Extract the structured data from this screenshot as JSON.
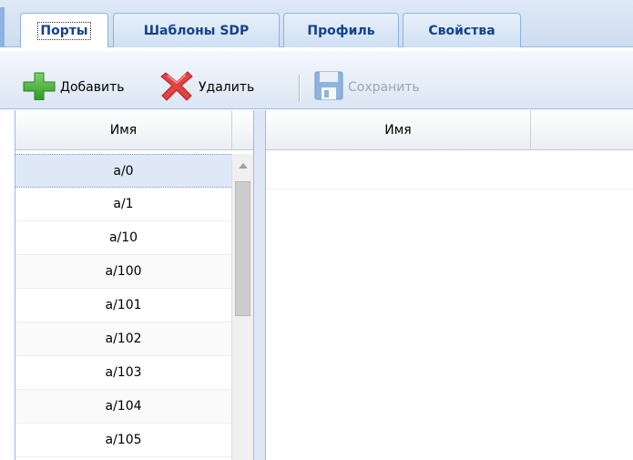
{
  "tabs": [
    {
      "label": "Порты",
      "active": true
    },
    {
      "label": "Шаблоны SDP",
      "active": false
    },
    {
      "label": "Профиль",
      "active": false
    },
    {
      "label": "Свойства",
      "active": false
    }
  ],
  "toolbar": {
    "add_label": "Добавить",
    "delete_label": "Удалить",
    "save_label": "Сохранить",
    "add_icon": "plus-icon",
    "delete_icon": "red-x-icon",
    "save_icon": "floppy-disk-icon"
  },
  "left_grid": {
    "column_header": "Имя",
    "rows": [
      "a/0",
      "a/1",
      "a/10",
      "a/100",
      "a/101",
      "a/102",
      "a/103",
      "a/104",
      "a/105"
    ],
    "selected_index": 0
  },
  "right_grid": {
    "column_header": "Имя"
  },
  "colors": {
    "accent_border": "#99bbe8",
    "tab_text": "#15428b",
    "selected_row": "#dfe8f6"
  }
}
